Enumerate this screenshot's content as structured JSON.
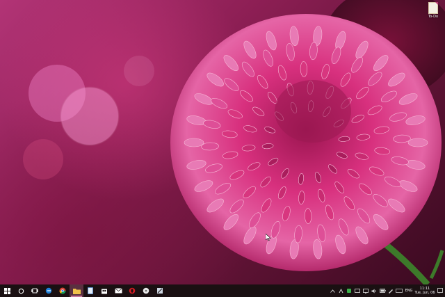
{
  "desktop": {
    "icons": [
      {
        "label": "To-Do",
        "icon": "document-icon"
      }
    ]
  },
  "taskbar": {
    "items": [
      {
        "name": "start-button",
        "icon": "windows-logo-icon"
      },
      {
        "name": "search-button",
        "icon": "search-circle-icon"
      },
      {
        "name": "task-view-button",
        "icon": "task-view-icon"
      },
      {
        "name": "edge-button",
        "icon": "edge-icon"
      },
      {
        "name": "chrome-button",
        "icon": "chrome-icon"
      },
      {
        "name": "file-explorer-button",
        "icon": "folder-icon",
        "active": true
      },
      {
        "name": "notepad-button",
        "icon": "notepad-icon"
      },
      {
        "name": "store-button",
        "icon": "store-icon"
      },
      {
        "name": "mail-button",
        "icon": "mail-icon"
      },
      {
        "name": "opera-button",
        "icon": "opera-icon"
      },
      {
        "name": "media-button",
        "icon": "media-icon"
      },
      {
        "name": "snipping-button",
        "icon": "snipping-icon"
      }
    ],
    "tray": {
      "language": "ENG",
      "time": "11:11",
      "date": "Tue, Jun, 06"
    }
  },
  "colors": {
    "taskbar_bg": "#1a1012",
    "accent": "#c8789e"
  }
}
